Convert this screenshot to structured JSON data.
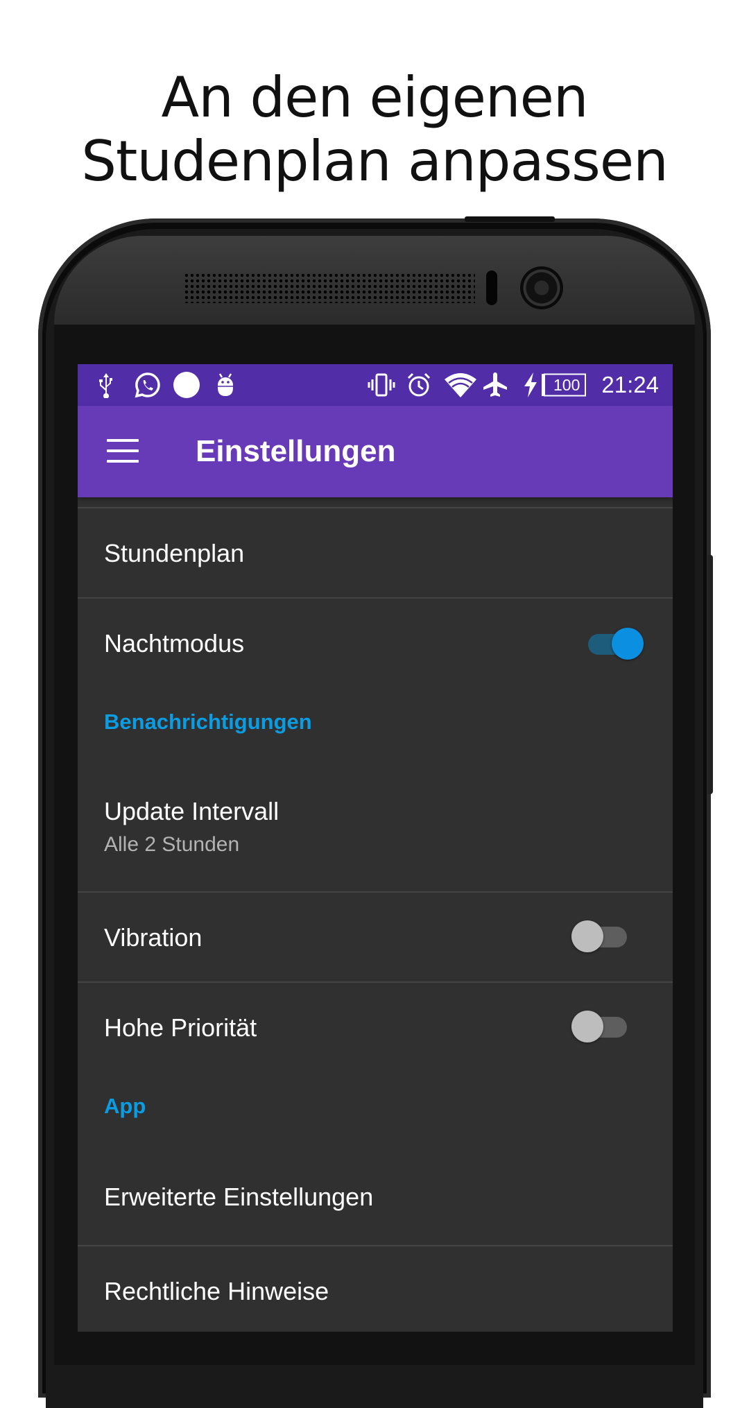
{
  "headline": {
    "line1": "An den eigenen",
    "line2": "Studenplan anpassen"
  },
  "statusbar": {
    "left_icons": [
      "usb-icon",
      "whatsapp-icon",
      "circle-notification-icon",
      "android-debug-icon"
    ],
    "right_icons": [
      "vibrate-icon",
      "alarm-icon",
      "wifi-icon",
      "airplane-icon",
      "charging-icon"
    ],
    "battery": "100",
    "time": "21:24"
  },
  "appbar": {
    "title": "Einstellungen"
  },
  "settings": {
    "stundenplan": "Stundenplan",
    "nachtmodus": "Nachtmodus",
    "nachtmodus_on": true,
    "cat_benachrichtigungen": "Benachrichtigungen",
    "update_intervall": "Update Intervall",
    "update_intervall_summary": "Alle 2 Stunden",
    "vibration": "Vibration",
    "vibration_on": false,
    "hohe_prioritaet": "Hohe Priorität",
    "hohe_prioritaet_on": false,
    "cat_app": "App",
    "erweiterte": "Erweiterte Einstellungen",
    "rechtliche": "Rechtliche Hinweise"
  },
  "colors": {
    "statusbar": "#512da8",
    "appbar": "#673ab7",
    "background": "#303030",
    "accent": "#0b9de3"
  }
}
